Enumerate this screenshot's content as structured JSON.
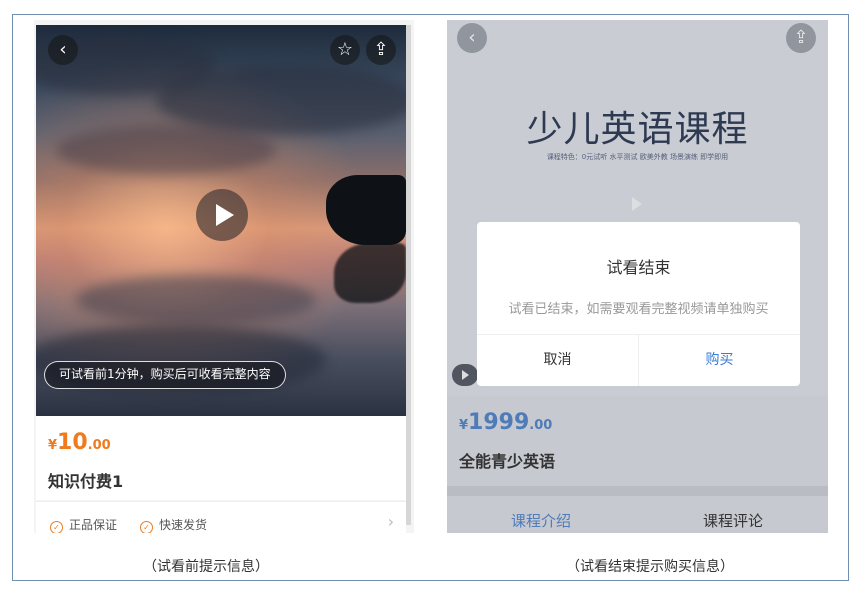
{
  "left": {
    "hint": "可试看前1分钟，购买后可收看完整内容",
    "price": {
      "currency": "¥",
      "integer": "10",
      "decimal": ".00"
    },
    "product_name": "知识付费1",
    "guarantees": [
      "正品保证",
      "快速发货"
    ],
    "icons": {
      "back": "‹",
      "star": "☆",
      "share": "⇪",
      "check": "✓",
      "chevron": "›"
    }
  },
  "right": {
    "course_title": "少儿英语课程",
    "course_subtitle": "课程特色：0元试听 水平测试 欧美外教 场景演练 即学即用",
    "price": {
      "currency": "¥",
      "integer": "1999",
      "decimal": ".00"
    },
    "product_name": "全能青少英语",
    "tabs": [
      "课程介绍",
      "课程评论"
    ],
    "modal": {
      "title": "试看结束",
      "message": "试看已结束，如需要观看完整视频请单独购买",
      "cancel": "取消",
      "buy": "购买"
    },
    "icons": {
      "back": "‹",
      "share": "⇪"
    }
  },
  "captions": {
    "left": "（试看前提示信息）",
    "right": "（试看结束提示购买信息）"
  },
  "colors": {
    "orange": "#ef7b1e",
    "blue": "#4f7bb8",
    "frame": "#6f8fb0"
  }
}
